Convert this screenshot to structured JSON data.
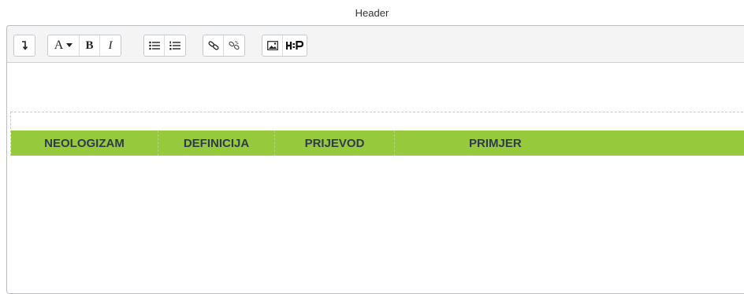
{
  "field": {
    "label": "Header"
  },
  "toolbar": {
    "groups": [
      [
        {
          "name": "expand-toolbar-button",
          "icon": "arrow-down-icon",
          "glyph": "↴"
        }
      ],
      [
        {
          "name": "paragraph-style-button",
          "icon": "font-style-icon",
          "glyph": "A ▾"
        },
        {
          "name": "bold-button",
          "icon": "bold-icon",
          "glyph": "B"
        },
        {
          "name": "italic-button",
          "icon": "italic-icon",
          "glyph": "I"
        }
      ],
      [
        {
          "name": "unordered-list-button",
          "icon": "bullet-list-icon",
          "glyph": "☰"
        },
        {
          "name": "ordered-list-button",
          "icon": "numbered-list-icon",
          "glyph": "☷"
        }
      ],
      [
        {
          "name": "link-button",
          "icon": "link-icon",
          "glyph": "🔗"
        },
        {
          "name": "unlink-button",
          "icon": "unlink-icon",
          "glyph": "⛓"
        }
      ],
      [
        {
          "name": "insert-image-button",
          "icon": "image-icon",
          "glyph": "▣"
        },
        {
          "name": "insert-h5p-button",
          "icon": "h5p-icon",
          "glyph": "H-P"
        }
      ]
    ]
  },
  "table": {
    "headers": [
      "NEOLOGIZAM",
      "DEFINICIJA",
      "PRIJEVOD",
      "PRIMJER"
    ],
    "header_bg": "#97c93d",
    "header_text_color": "#2f3b4a"
  }
}
